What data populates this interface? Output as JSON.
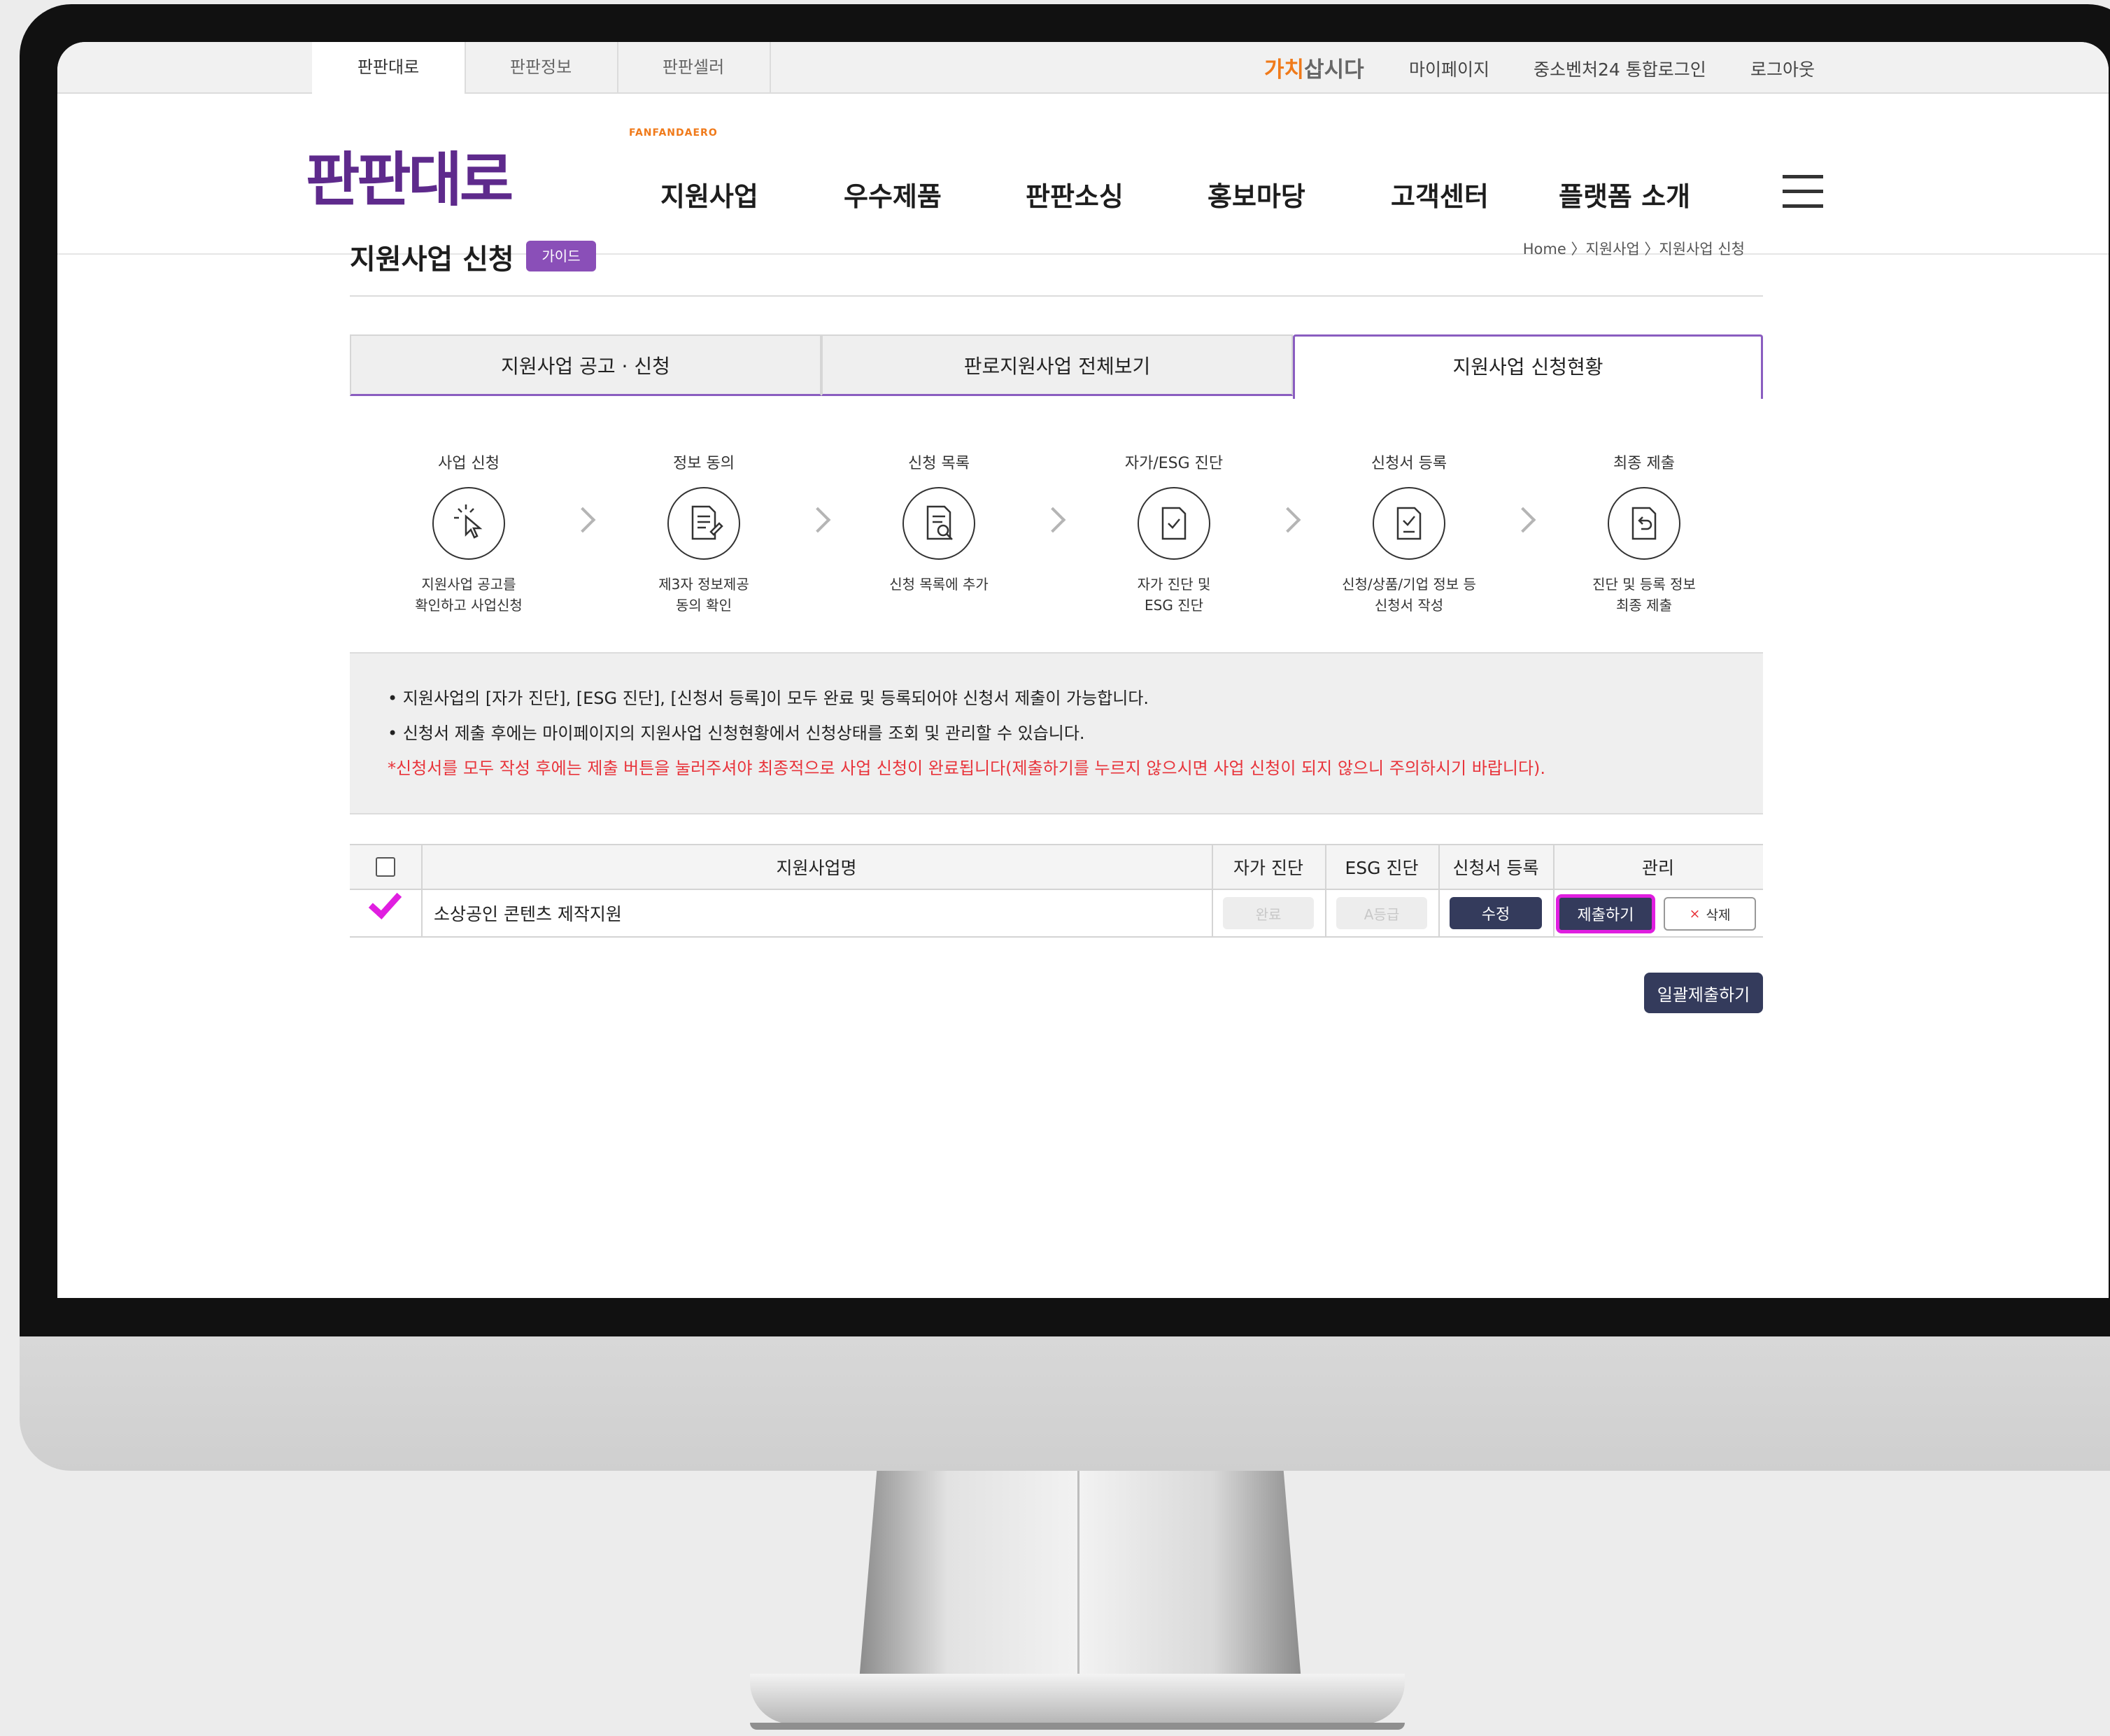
{
  "site_tabs": [
    {
      "label": "판판대로"
    },
    {
      "label": "판판정보"
    },
    {
      "label": "판판셀러"
    }
  ],
  "utility": {
    "brand_orange": "가치",
    "brand_gray": "삽시다",
    "links": [
      "마이페이지",
      "중소벤처24 통합로그인",
      "로그아웃"
    ]
  },
  "logo": {
    "small": "FANFANDAERO",
    "main": "판판대로"
  },
  "gnb": [
    "지원사업",
    "우수제품",
    "판판소싱",
    "홍보마당",
    "고객센터",
    "플랫폼 소개"
  ],
  "page": {
    "title": "지원사업 신청",
    "guide_badge": "가이드",
    "breadcrumb": "Home 〉지원사업 〉지원사업 신청"
  },
  "tabs": [
    "지원사업 공고 · 신청",
    "판로지원사업 전체보기",
    "지원사업 신청현황"
  ],
  "steps": [
    {
      "title": "사업 신청",
      "desc": "지원사업 공고를\n확인하고 사업신청",
      "icon": "cursor-click-icon"
    },
    {
      "title": "정보 동의",
      "desc": "제3자 정보제공\n동의 확인",
      "icon": "document-edit-icon"
    },
    {
      "title": "신청 목록",
      "desc": "신청 목록에 추가",
      "icon": "document-search-icon"
    },
    {
      "title": "자가/ESG 진단",
      "desc": "자가 진단 및\nESG 진단",
      "icon": "clipboard-check-icon"
    },
    {
      "title": "신청서 등록",
      "desc": "신청/상품/기업 정보 등\n신청서 작성",
      "icon": "document-check-icon"
    },
    {
      "title": "최종 제출",
      "desc": "진단 및 등록 정보\n최종 제출",
      "icon": "document-return-icon"
    }
  ],
  "notice": [
    "• 지원사업의 [자가 진단], [ESG 진단], [신청서 등록]이 모두 완료 및 등록되어야 신청서 제출이 가능합니다.",
    "• 신청서 제출 후에는 마이페이지의 지원사업 신청현황에서 신청상태를 조회 및 관리할 수 있습니다.",
    "*신청서를 모두 작성 후에는 제출 버튼을 눌러주셔야 최종적으로 사업 신청이 완료됩니다(제출하기를 누르지 않으시면 사업 신청이 되지 않으니 주의하시기 바랍니다)."
  ],
  "table": {
    "headers": [
      "지원사업명",
      "자가 진단",
      "ESG 진단",
      "신청서 등록",
      "관리"
    ],
    "rows": [
      {
        "name": "소상공인 콘텐츠 제작지원",
        "self_diag": "완료",
        "esg": "A등급",
        "register": "수정",
        "submit": "제출하기",
        "delete": "삭제"
      }
    ]
  },
  "bulk_submit": "일괄제출하기",
  "colors": {
    "brand_purple": "#5e2a8c",
    "accent_purple": "#8a4fb8",
    "navy": "#343b5c",
    "highlight": "#e01ee0",
    "warning_red": "#e8343b"
  }
}
